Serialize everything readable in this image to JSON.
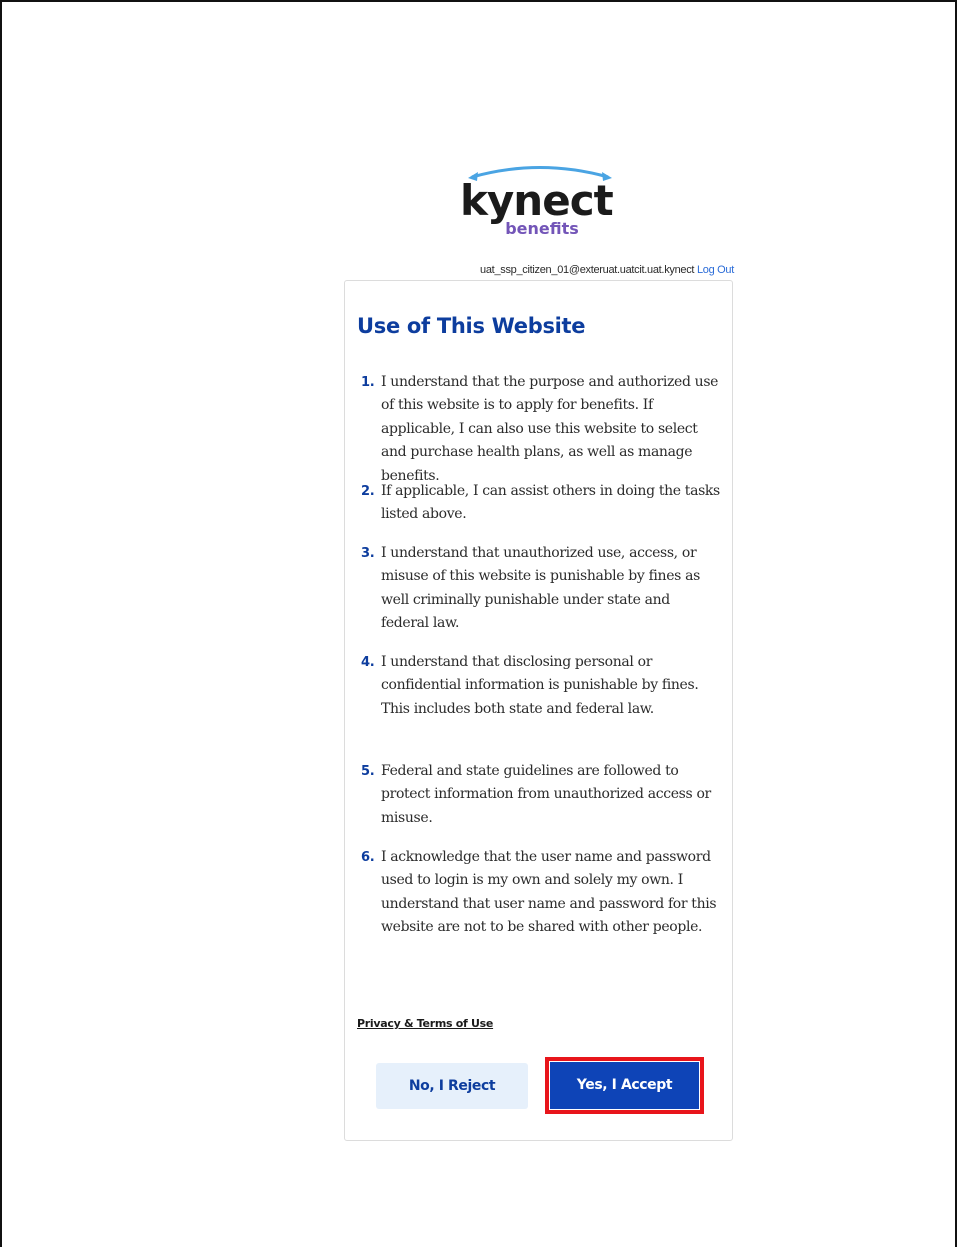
{
  "brand": {
    "name": "kynect",
    "subtitle": "benefits",
    "colors": {
      "primary_blue": "#0d3d9e",
      "accent_purple": "#7355b8",
      "arc_blue": "#4aa4e3",
      "highlight_red": "#e8151b"
    }
  },
  "header": {
    "user_email": "uat_ssp_citizen_01@exteruat.uatcit.uat.kynect",
    "logout_label": "Log Out"
  },
  "card": {
    "title": "Use of This Website",
    "terms": [
      {
        "num": "1.",
        "text": "I understand that the purpose and authorized use of this website is to apply for benefits. If applicable, I can also use this website to select and purchase health plans, as well as manage benefits."
      },
      {
        "num": "2.",
        "text": "If applicable, I can assist others in doing the tasks listed above."
      },
      {
        "num": "3.",
        "text": "I understand that unauthorized use, access, or misuse of this website is punishable by fines as well criminally punishable under state and federal law."
      },
      {
        "num": "4.",
        "text": "I understand that disclosing personal or confidential information is punishable by fines. This includes both state and federal law."
      },
      {
        "num": "5.",
        "text": "Federal and state guidelines are followed to protect information from unauthorized access or misuse."
      },
      {
        "num": "6.",
        "text": "I acknowledge that the user name and password used to login is my own and solely my own. I understand that user name and password for this website are not to be shared with other people."
      }
    ],
    "privacy_link": "Privacy & Terms of Use",
    "reject_label": "No, I Reject",
    "accept_label": "Yes, I Accept"
  }
}
